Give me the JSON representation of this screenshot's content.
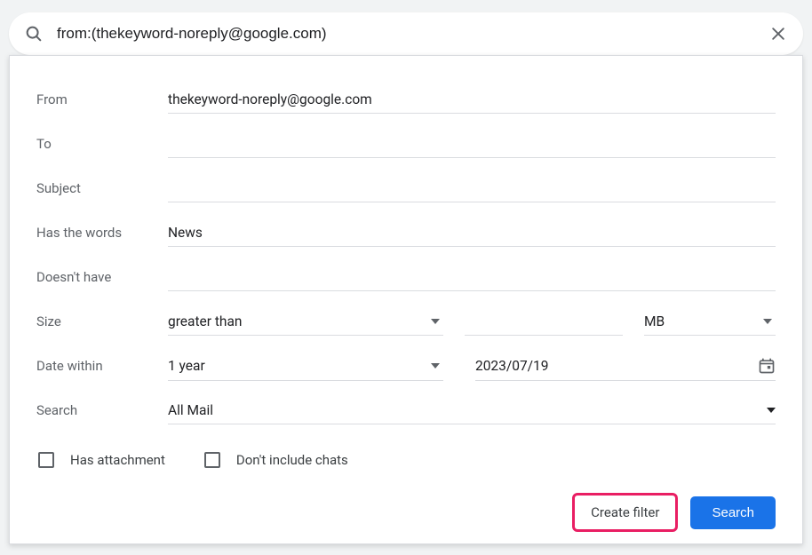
{
  "search_bar": {
    "query": "from:(thekeyword-noreply@google.com)"
  },
  "form": {
    "from": {
      "label": "From",
      "value": "thekeyword-noreply@google.com"
    },
    "to": {
      "label": "To",
      "value": ""
    },
    "subject": {
      "label": "Subject",
      "value": ""
    },
    "has_words": {
      "label": "Has the words",
      "value": "News"
    },
    "doesnt_have": {
      "label": "Doesn't have",
      "value": ""
    },
    "size": {
      "label": "Size",
      "condition": "greater than",
      "value": "",
      "unit": "MB"
    },
    "date_within": {
      "label": "Date within",
      "range": "1 year",
      "date": "2023/07/19"
    },
    "search_scope": {
      "label": "Search",
      "value": "All Mail"
    }
  },
  "checkboxes": {
    "has_attachment": "Has attachment",
    "dont_include_chats": "Don't include chats"
  },
  "buttons": {
    "create_filter": "Create filter",
    "search": "Search"
  }
}
